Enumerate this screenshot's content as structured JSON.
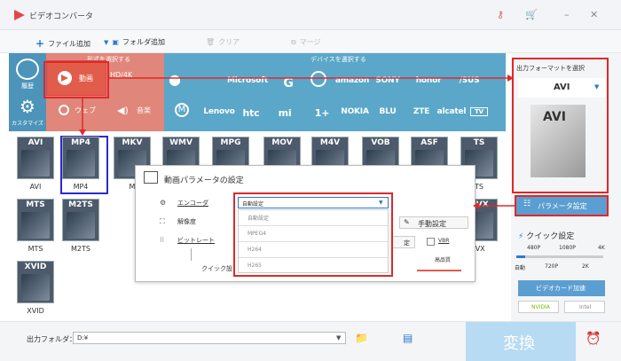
{
  "app": {
    "title": "ビデオコンバータ"
  },
  "toolbar": {
    "add_file": "ファイル追加",
    "add_folder": "フォルダ追加",
    "clear": "クリア",
    "merge": "マージ"
  },
  "side": {
    "history": "履歴",
    "customize": "カスタマイズ"
  },
  "tabs": {
    "format_select": "形式を選択する",
    "device_select": "デバイスを選択する",
    "video": "動画",
    "hd": "HD/4K",
    "web": "ウェブ",
    "audio": "音楽"
  },
  "brands_row1": [
    "",
    "Microsoft",
    "G",
    "",
    "amazon",
    "SONY",
    "honor",
    "/SUS"
  ],
  "brands_row2": [
    "",
    "Lenovo",
    "htc",
    "mi",
    "1+",
    "NOKIA",
    "BLU",
    "ZTE",
    "alcatel",
    "TV"
  ],
  "formats_row1": [
    {
      "badge": "AVI",
      "name": "AVI"
    },
    {
      "badge": "MP4",
      "name": "MP4"
    },
    {
      "badge": "MKV",
      "name": "M"
    },
    {
      "badge": "WMV",
      "name": ""
    },
    {
      "badge": "MPG",
      "name": ""
    },
    {
      "badge": "MOV",
      "name": ""
    },
    {
      "badge": "M4V",
      "name": ""
    },
    {
      "badge": "VOB",
      "name": ""
    },
    {
      "badge": "ASF",
      "name": ""
    },
    {
      "badge": "TS",
      "name": "TS"
    }
  ],
  "formats_row2": [
    {
      "badge": "MTS",
      "name": "MTS"
    },
    {
      "badge": "M2TS",
      "name": "M2TS"
    },
    {
      "badge": "DVX",
      "name": "IVX"
    }
  ],
  "formats_row3": [
    {
      "badge": "XVID",
      "name": "XVID"
    }
  ],
  "right": {
    "output_format_label": "出力フォーマットを選択",
    "selected_format": "AVI",
    "param_button": "パラメータ設定",
    "quick_settings": "クイック設定",
    "res_top": [
      "480P",
      "1080P",
      "4K"
    ],
    "res_bottom": [
      "自動",
      "720P",
      "2K"
    ],
    "gpu_button": "ビデオカード加速",
    "gpu_nvidia": "NVIDIA",
    "gpu_intel": "Intel"
  },
  "dialog": {
    "title": "動画パラメータの設定",
    "encoder_label": "エンコーダ",
    "resolution_label": "解像度",
    "bitrate_label": "ビットレート",
    "quick_label": "クイック設",
    "manual_button": "手動設定",
    "vbr_label": "VBR",
    "quality_label": "高品質",
    "preset_btn": "定",
    "dropdown_value": "自動設定",
    "options": [
      "自動設定",
      "MPEG4",
      "H264",
      "H265"
    ]
  },
  "bottom": {
    "output_folder_label": "出力フォルダ：",
    "output_path": "D:¥",
    "convert_button": "変換"
  }
}
